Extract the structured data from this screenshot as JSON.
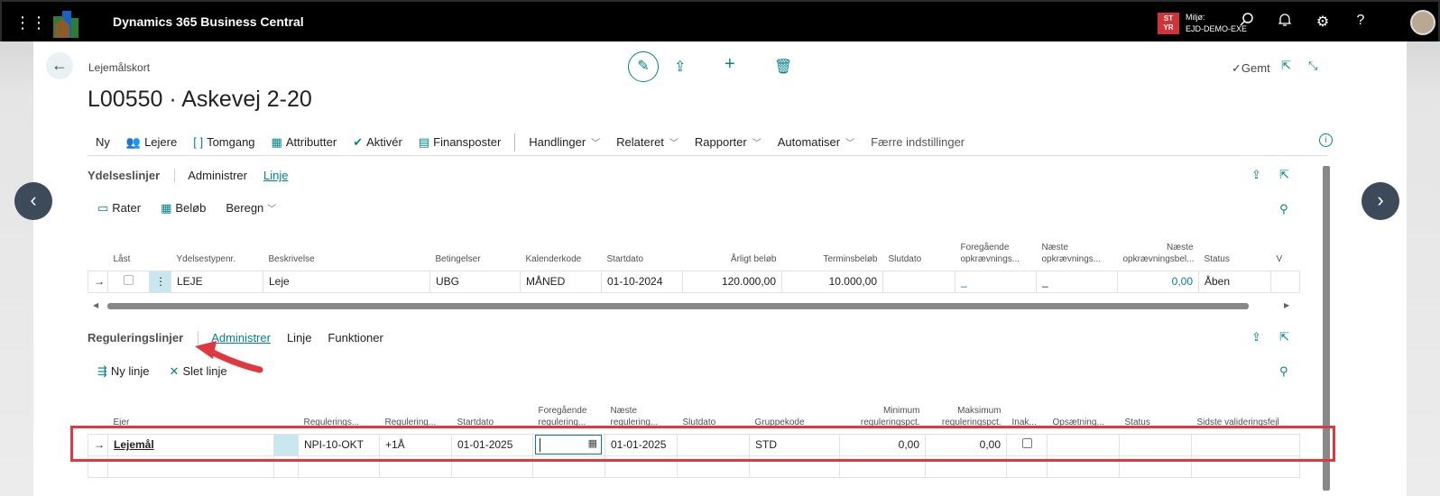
{
  "app": {
    "title": "Dynamics 365 Business Central",
    "env_badge_line1": "ST",
    "env_badge_line2": "YR",
    "env_label": "Miljø:",
    "env_name": "EJD-DEMO-EXE"
  },
  "page": {
    "breadcrumb": "Lejemålskort",
    "title": "L00550 · Askevej 2-20",
    "saved": "Gemt"
  },
  "actions": [
    {
      "label": "Ny",
      "icon": ""
    },
    {
      "label": "Lejere",
      "icon": "people-icon"
    },
    {
      "label": "Tomgang",
      "icon": "brackets-icon"
    },
    {
      "label": "Attributter",
      "icon": "grid-icon"
    },
    {
      "label": "Aktivér",
      "icon": "check-icon"
    },
    {
      "label": "Finansposter",
      "icon": "ledger-icon"
    }
  ],
  "menus": [
    "Handlinger",
    "Relateret",
    "Rapporter",
    "Automatiser",
    "Færre indstillinger"
  ],
  "ydelse": {
    "title": "Ydelseslinjer",
    "tabs": [
      "Administrer",
      "Linje"
    ],
    "actions": [
      "Rater",
      "Beløb",
      "Beregn"
    ],
    "columns": [
      "Låst",
      "Ydelsestypenr.",
      "Beskrivelse",
      "Betingelser",
      "Kalenderkode",
      "Startdato",
      "Årligt beløb",
      "Terminsbeløb",
      "Slutdato",
      "Foregående opkrævnings...",
      "Næste opkrævnings...",
      "Næste opkrævningsbel...",
      "Status",
      "V"
    ],
    "row": {
      "type": "LEJE",
      "description": "Leje",
      "terms": "UBG",
      "calendar": "MÅNED",
      "start": "01-10-2024",
      "annual": "120.000,00",
      "term_amount": "10.000,00",
      "end": "",
      "prev": "_",
      "next": "_",
      "next_amount": "0,00",
      "status": "Åben"
    }
  },
  "regulering": {
    "title": "Reguleringslinjer",
    "tabs": [
      "Administrer",
      "Linje",
      "Funktioner"
    ],
    "actions": [
      "Ny linje",
      "Slet linje"
    ],
    "columns": [
      "Ejer",
      "Regulerings...",
      "Regulering...",
      "Startdato",
      "Foregående regulering...",
      "Næste regulering...",
      "Slutdato",
      "Gruppekode",
      "Minimum reguleringspct.",
      "Maksimum reguleringspct.",
      "Inak...",
      "Opsætning...",
      "Status",
      "Sidste valideringsfejl"
    ],
    "row": {
      "owner": "Lejemål",
      "code": "NPI-10-OKT",
      "formula": "+1Å",
      "start": "01-01-2025",
      "prev": "",
      "next": "01-01-2025",
      "end": "",
      "group": "STD",
      "min": "0,00",
      "max": "0,00"
    }
  }
}
